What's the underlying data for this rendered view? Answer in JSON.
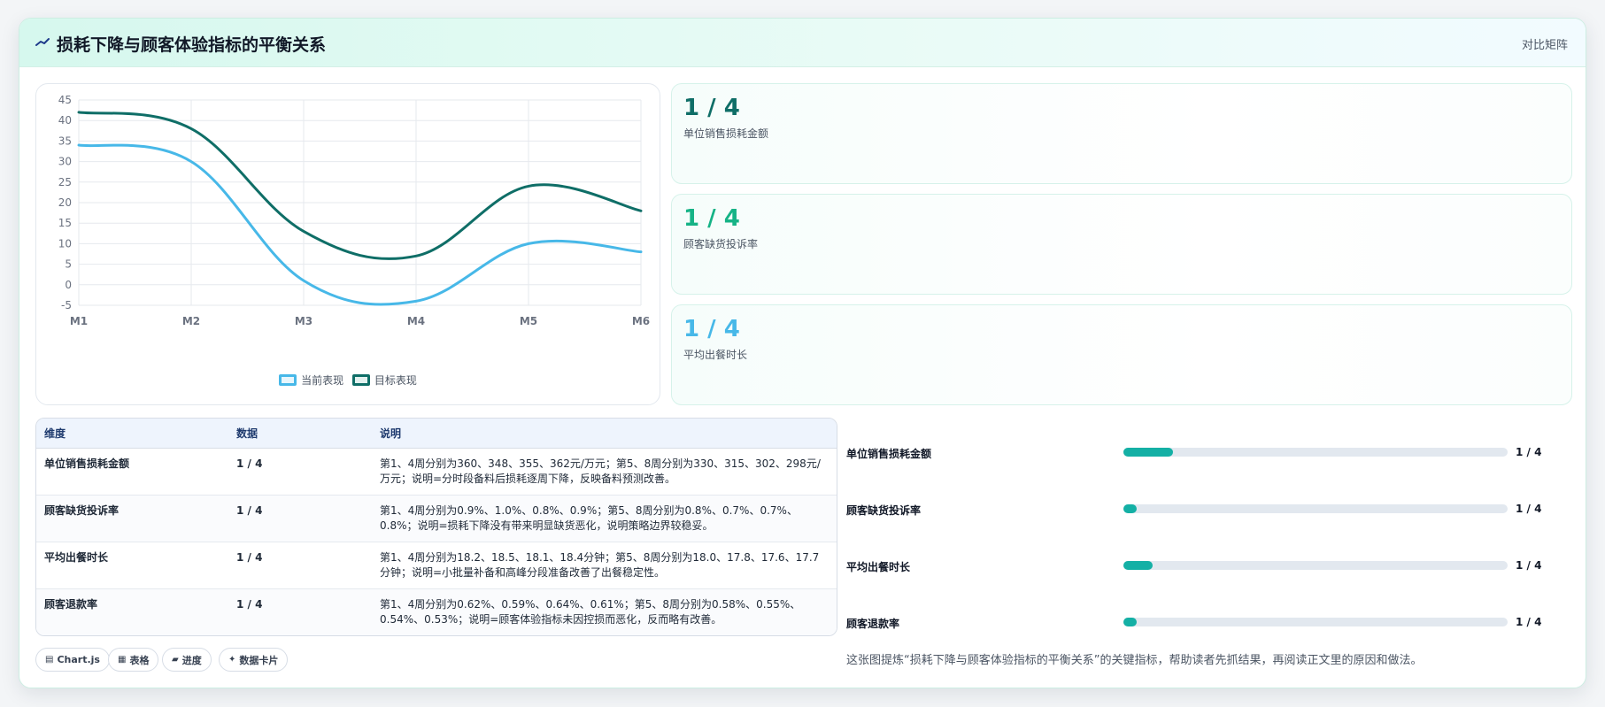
{
  "header": {
    "title": "损耗下降与顾客体验指标的平衡关系",
    "action_label": "对比矩阵"
  },
  "chart_data": {
    "type": "line",
    "categories": [
      "M1",
      "M2",
      "M3",
      "M4",
      "M5",
      "M6"
    ],
    "series": [
      {
        "name": "当前表现",
        "values": [
          34,
          30,
          1,
          -4,
          10,
          8
        ],
        "color": "#47b8e8"
      },
      {
        "name": "目标表现",
        "values": [
          42,
          38,
          13,
          7,
          24,
          18
        ],
        "color": "#0f6e67"
      }
    ],
    "ylim": [
      -5,
      45
    ],
    "yticks": [
      -5,
      0,
      5,
      10,
      15,
      20,
      25,
      30,
      35,
      40,
      45
    ],
    "grid": true,
    "legend": "bottom"
  },
  "stats": [
    {
      "value": "1 / 4",
      "label": "单位销售损耗金额",
      "color": "#0f6e67"
    },
    {
      "value": "1 / 4",
      "label": "顾客缺货投诉率",
      "color": "#16b386"
    },
    {
      "value": "1 / 4",
      "label": "平均出餐时长",
      "color": "#47b8e8"
    }
  ],
  "table": {
    "headers": {
      "dim": "维度",
      "data": "数据",
      "desc": "说明"
    },
    "rows": [
      {
        "dim": "单位销售损耗金额",
        "data": "1 / 4",
        "desc": "第1、4周分别为360、348、355、362元/万元；第5、8周分别为330、315、302、298元/万元；说明=分时段备料后损耗逐周下降，反映备料预测改善。"
      },
      {
        "dim": "顾客缺货投诉率",
        "data": "1 / 4",
        "desc": "第1、4周分别为0.9%、1.0%、0.8%、0.9%；第5、8周分别为0.8%、0.7%、0.7%、0.8%；说明=损耗下降没有带来明显缺货恶化，说明策略边界较稳妥。"
      },
      {
        "dim": "平均出餐时长",
        "data": "1 / 4",
        "desc": "第1、4周分别为18.2、18.5、18.1、18.4分钟；第5、8周分别为18.0、17.8、17.6、17.7分钟；说明=小批量补备和高峰分段准备改善了出餐稳定性。"
      },
      {
        "dim": "顾客退款率",
        "data": "1 / 4",
        "desc": "第1、4周分别为0.62%、0.59%、0.64%、0.61%；第5、8周分别为0.58%、0.55%、0.54%、0.53%；说明=顾客体验指标未因控损而恶化，反而略有改善。"
      }
    ]
  },
  "chips": [
    {
      "icon": "▤",
      "label": "Chart.js"
    },
    {
      "icon": "▦",
      "label": "表格"
    },
    {
      "icon": "▰",
      "label": "进度"
    },
    {
      "icon": "✦",
      "label": "数据卡片"
    }
  ],
  "progress": [
    {
      "label": "单位销售损耗金额",
      "value": "1 / 4",
      "fraction": 0.13
    },
    {
      "label": "顾客缺货投诉率",
      "value": "1 / 4",
      "fraction": 0.035
    },
    {
      "label": "平均出餐时长",
      "value": "1 / 4",
      "fraction": 0.075
    },
    {
      "label": "顾客退款率",
      "value": "1 / 4",
      "fraction": 0.035
    }
  ],
  "caption": "这张图提炼“损耗下降与顾客体验指标的平衡关系”的关键指标，帮助读者先抓结果，再阅读正文里的原因和做法。"
}
